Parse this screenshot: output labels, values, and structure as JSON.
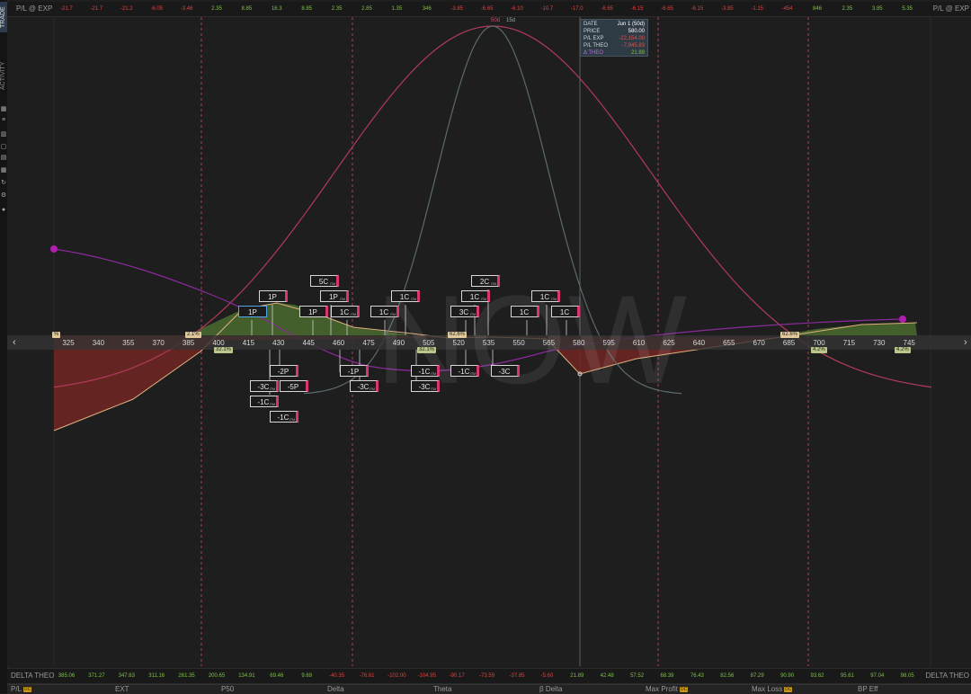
{
  "sidebar": {
    "tab_trade": "TRADE",
    "tab_activity": "ACTIVITY",
    "icons": [
      "grid-icon",
      "list-icon",
      "bars-icon",
      "window-icon",
      "columns-icon",
      "table-icon",
      "refresh-icon",
      "settings-icon",
      "help-icon"
    ]
  },
  "top_strip": {
    "label_left": "P/L @ EXP",
    "label_right": "P/L @ EXP",
    "cells": [
      {
        "text": "-21.7",
        "tone": "neg"
      },
      {
        "text": "-21.7",
        "tone": "neg"
      },
      {
        "text": "-21.2",
        "tone": "neg"
      },
      {
        "text": "-6.05",
        "tone": "neg"
      },
      {
        "text": "-3.46",
        "tone": "neg"
      },
      {
        "text": "2.35",
        "tone": "pos"
      },
      {
        "text": "8.85",
        "tone": "pos"
      },
      {
        "text": "16.3",
        "tone": "pos"
      },
      {
        "text": "8.85",
        "tone": "pos"
      },
      {
        "text": "2.35",
        "tone": "pos"
      },
      {
        "text": "2.85",
        "tone": "pos"
      },
      {
        "text": "1.35",
        "tone": "pos"
      },
      {
        "text": "346",
        "tone": "pos"
      },
      {
        "text": "-3.85",
        "tone": "neg"
      },
      {
        "text": "-6.65",
        "tone": "neg"
      },
      {
        "text": "-6.10",
        "tone": "neg"
      },
      {
        "text": "-10.7",
        "tone": "neg"
      },
      {
        "text": "-17.0",
        "tone": "neg"
      },
      {
        "text": "-6.65",
        "tone": "neg"
      },
      {
        "text": "-6.15",
        "tone": "neg"
      },
      {
        "text": "-6.65",
        "tone": "neg"
      },
      {
        "text": "-6.15",
        "tone": "neg"
      },
      {
        "text": "-3.85",
        "tone": "neg"
      },
      {
        "text": "-1.15",
        "tone": "neg"
      },
      {
        "text": "-454",
        "tone": "neg"
      },
      {
        "text": "846",
        "tone": "pos"
      },
      {
        "text": "2.35",
        "tone": "pos"
      },
      {
        "text": "3.85",
        "tone": "pos"
      },
      {
        "text": "5.35",
        "tone": "pos"
      }
    ]
  },
  "bottom_strip": {
    "label_left": "DELTA THEO",
    "label_right": "DELTA THEO",
    "cells": [
      {
        "text": "385.06",
        "tone": "pos"
      },
      {
        "text": "371.27",
        "tone": "pos"
      },
      {
        "text": "347.63",
        "tone": "pos"
      },
      {
        "text": "311.16",
        "tone": "pos"
      },
      {
        "text": "261.35",
        "tone": "pos"
      },
      {
        "text": "200.65",
        "tone": "pos"
      },
      {
        "text": "134.91",
        "tone": "pos"
      },
      {
        "text": "69.46",
        "tone": "pos"
      },
      {
        "text": "9.69",
        "tone": "pos"
      },
      {
        "text": "-40.35",
        "tone": "neg"
      },
      {
        "text": "-76.61",
        "tone": "neg"
      },
      {
        "text": "-102.00",
        "tone": "neg"
      },
      {
        "text": "-104.95",
        "tone": "neg"
      },
      {
        "text": "-90.17",
        "tone": "neg"
      },
      {
        "text": "-73.59",
        "tone": "neg"
      },
      {
        "text": "-37.85",
        "tone": "neg"
      },
      {
        "text": "-5.60",
        "tone": "neg"
      },
      {
        "text": "21.89",
        "tone": "pos"
      },
      {
        "text": "42.48",
        "tone": "pos"
      },
      {
        "text": "57.52",
        "tone": "pos"
      },
      {
        "text": "68.39",
        "tone": "pos"
      },
      {
        "text": "76.43",
        "tone": "pos"
      },
      {
        "text": "82.56",
        "tone": "pos"
      },
      {
        "text": "87.29",
        "tone": "pos"
      },
      {
        "text": "90.90",
        "tone": "pos"
      },
      {
        "text": "93.62",
        "tone": "pos"
      },
      {
        "text": "95.61",
        "tone": "pos"
      },
      {
        "text": "97.04",
        "tone": "pos"
      },
      {
        "text": "98.05",
        "tone": "pos"
      }
    ]
  },
  "footer": {
    "columns": [
      {
        "label": "P/L",
        "badge": "DC"
      },
      {
        "label": "EXT",
        "badge": ""
      },
      {
        "label": "P50",
        "badge": ""
      },
      {
        "label": "Delta",
        "badge": ""
      },
      {
        "label": "Theta",
        "badge": ""
      },
      {
        "label": "β Delta",
        "badge": ""
      },
      {
        "label": "Max Profit",
        "badge": "DC"
      },
      {
        "label": "Max Loss",
        "badge": "DC"
      },
      {
        "label": "BP Eff",
        "badge": ""
      }
    ]
  },
  "info_box": {
    "date_label": "DATE",
    "date_value": "Jun 1 (50d)",
    "price_label": "PRICE",
    "price_value": "580.00",
    "pl_exp_label": "P/L EXP",
    "pl_exp_value": "-22,154.00",
    "pl_theo_label": "P/L THEO",
    "pl_theo_value": "-7,945.83",
    "delta_label": "Δ THEO",
    "delta_value": "21.89"
  },
  "day_labels": {
    "left": "50d",
    "right": "15d"
  },
  "watermark": "NOW",
  "axis": {
    "ticks": [
      "325",
      "340",
      "355",
      "370",
      "385",
      "400",
      "415",
      "430",
      "445",
      "460",
      "475",
      "490",
      "505",
      "520",
      "535",
      "550",
      "565",
      "580",
      "595",
      "610",
      "625",
      "640",
      "655",
      "670",
      "685",
      "700",
      "715",
      "730",
      "745"
    ]
  },
  "tags": [
    {
      "text": "%",
      "style": "plain"
    },
    {
      "text": "2.1%",
      "style": "plain"
    },
    {
      "text": "32.1%",
      "style": "green"
    },
    {
      "text": "32.1%",
      "style": "green"
    },
    {
      "text": "62.6%",
      "style": "plain"
    },
    {
      "text": "62.6%",
      "style": "plain"
    },
    {
      "text": "4.2%",
      "style": "green"
    },
    {
      "text": "4.2%",
      "style": "green"
    }
  ],
  "legs_upper": [
    "1P",
    "1P",
    "5C",
    "1P",
    "1P",
    "1C",
    "1C",
    "1C",
    "1C",
    "2C",
    "1C",
    "3C",
    "1C",
    "1C",
    "1C"
  ],
  "legs_lower": [
    "-2P",
    "-3C",
    "-5P",
    "-1C",
    "-1C",
    "-1P",
    "-3C",
    "-1C",
    "-3C",
    "-1C",
    "-3C"
  ],
  "chart_data": {
    "type": "line",
    "x_axis_ticks": [
      325,
      340,
      355,
      370,
      385,
      400,
      415,
      430,
      445,
      460,
      475,
      490,
      505,
      520,
      535,
      550,
      565,
      580,
      595,
      610,
      625,
      640,
      655,
      670,
      685,
      700,
      715,
      730,
      745
    ],
    "current_price": 580.0,
    "series": [],
    "colors": {
      "wide_curve": "#b23a5a",
      "narrow_curve": "#5a6a6e",
      "theta_line": "#8a2a9a",
      "profit_fill": "#4a6b2e",
      "loss_fill": "#6b2622",
      "pl_line": "#e0b080"
    }
  }
}
